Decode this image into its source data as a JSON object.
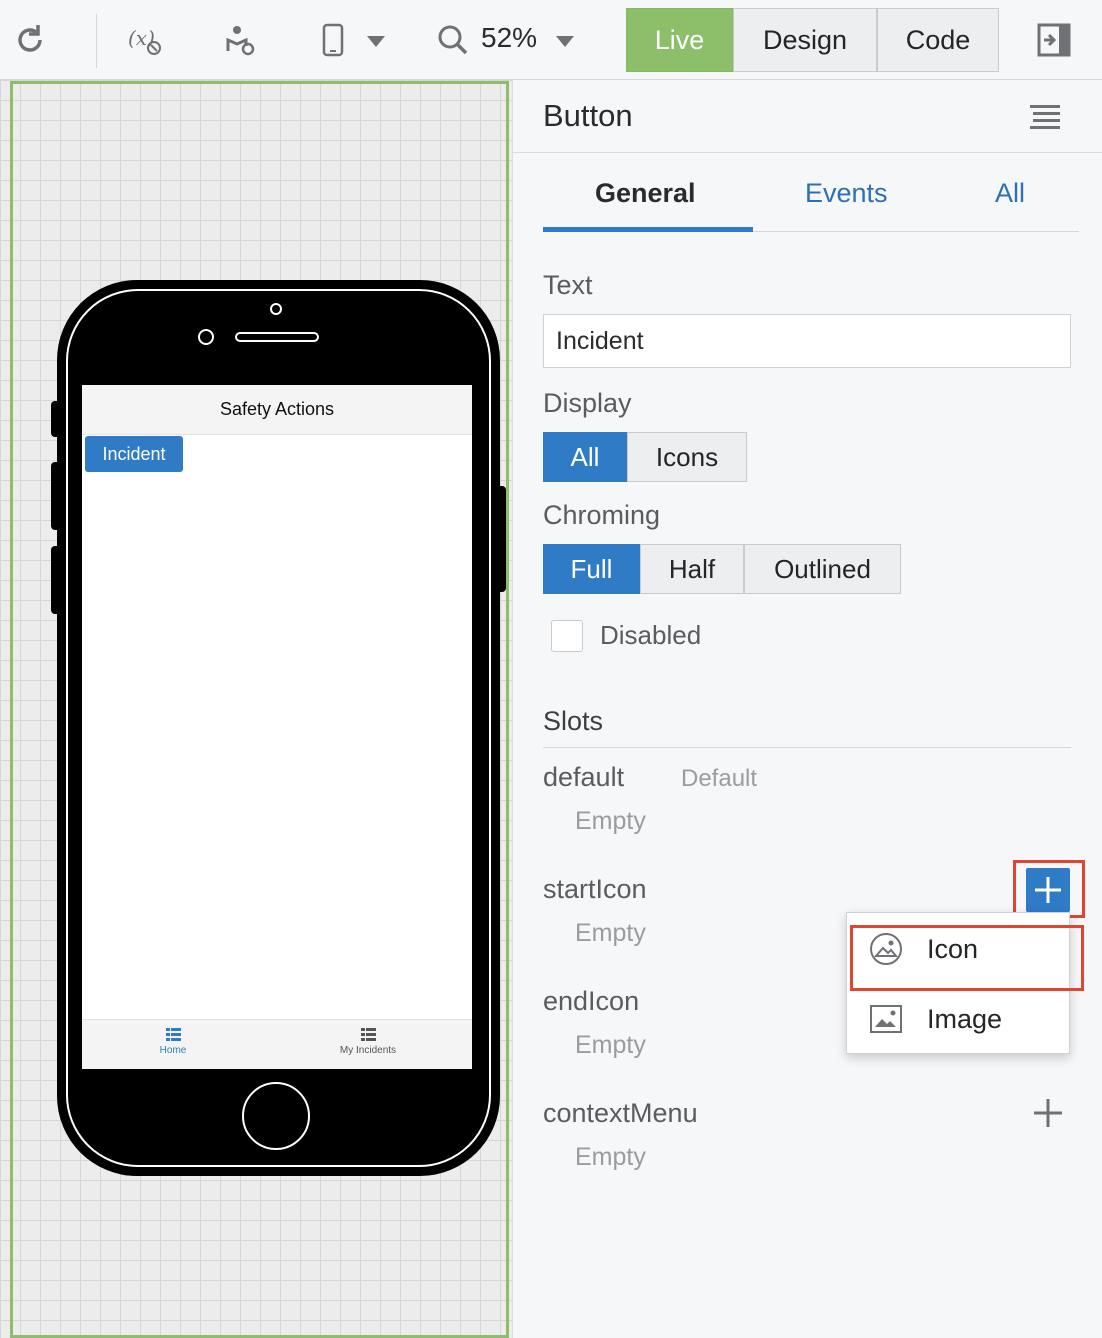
{
  "toolbar": {
    "zoom": "52%",
    "modes": [
      "Live",
      "Design",
      "Code"
    ],
    "active_mode": "Live"
  },
  "preview": {
    "app_title": "Safety Actions",
    "button_label": "Incident",
    "nav": [
      "Home",
      "My Incidents"
    ]
  },
  "panel": {
    "title": "Button",
    "tabs": [
      "General",
      "Events",
      "All"
    ],
    "text_label": "Text",
    "text_value": "Incident",
    "display_label": "Display",
    "display_options": [
      "All",
      "Icons"
    ],
    "chroming_label": "Chroming",
    "chroming_options": [
      "Full",
      "Half",
      "Outlined"
    ],
    "disabled_label": "Disabled",
    "slots_label": "Slots",
    "slots": [
      {
        "name": "default",
        "tag": "Default",
        "value": "Empty"
      },
      {
        "name": "startIcon",
        "value": "Empty"
      },
      {
        "name": "endIcon",
        "value": "Empty"
      },
      {
        "name": "contextMenu",
        "value": "Empty"
      }
    ],
    "add_menu": [
      "Icon",
      "Image"
    ]
  },
  "colors": {
    "accent": "#2f7bc6",
    "live": "#8dbf6a",
    "highlight": "#e0452f"
  }
}
